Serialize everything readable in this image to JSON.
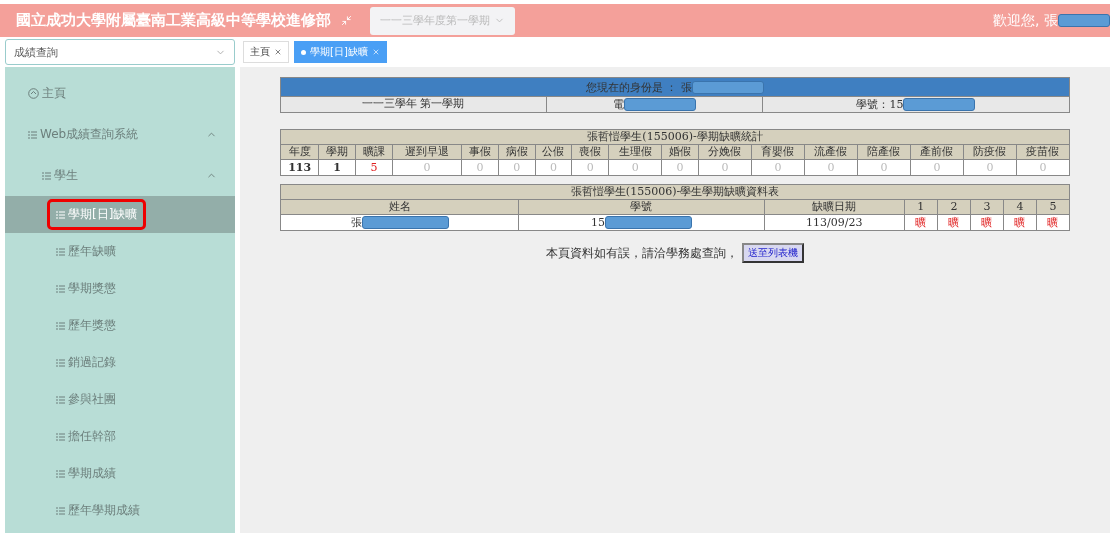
{
  "header": {
    "title": "國立成功大學附屬臺南工業高級中等學校進修部",
    "semester_select": {
      "placeholder": "一一三學年度第一學期"
    },
    "welcome": {
      "text": "歡迎您, 張",
      "redacted": true
    }
  },
  "module_select": {
    "value": "成績查詢"
  },
  "tabs": [
    {
      "label": "主頁",
      "selected": false
    },
    {
      "label": "學期[日]缺曠",
      "selected": true
    }
  ],
  "sidebar": {
    "items": [
      {
        "label": "主頁",
        "kind": "home",
        "selected": false,
        "highlighted": false
      },
      {
        "label": "Web成績查詢系統",
        "kind": "group",
        "expanded": true,
        "selected": false,
        "highlighted": false,
        "children": [
          {
            "label": "學生",
            "kind": "group",
            "expanded": true,
            "selected": false,
            "highlighted": false,
            "children": [
              {
                "label": "學期[日]缺曠",
                "kind": "leaf",
                "selected": true,
                "highlighted": true
              },
              {
                "label": "歷年缺曠",
                "kind": "leaf",
                "selected": false,
                "highlighted": false
              },
              {
                "label": "學期獎懲",
                "kind": "leaf",
                "selected": false,
                "highlighted": false
              },
              {
                "label": "歷年獎懲",
                "kind": "leaf",
                "selected": false,
                "highlighted": false
              },
              {
                "label": "銷過記錄",
                "kind": "leaf",
                "selected": false,
                "highlighted": false
              },
              {
                "label": "參與社團",
                "kind": "leaf",
                "selected": false,
                "highlighted": false
              },
              {
                "label": "擔任幹部",
                "kind": "leaf",
                "selected": false,
                "highlighted": false
              },
              {
                "label": "學期成績",
                "kind": "leaf",
                "selected": false,
                "highlighted": false
              },
              {
                "label": "歷年學期成績",
                "kind": "leaf",
                "selected": false,
                "highlighted": false
              }
            ]
          }
        ]
      }
    ]
  },
  "identity": {
    "title": {
      "text": "您現在的身份是 ： 張",
      "redacted": true
    },
    "cells": [
      {
        "text": "一一三學年 第一學期",
        "redacted": false
      },
      {
        "text": "電",
        "redacted": true
      },
      {
        "text": "學號：15",
        "redacted": true
      }
    ]
  },
  "stats": {
    "title": "張哲愷學生(155006)-學期缺曠統計",
    "columns": [
      "年度",
      "學期",
      "曠課",
      "遲到早退",
      "事假",
      "病假",
      "公假",
      "喪假",
      "生理假",
      "婚假",
      "分娩假",
      "育嬰假",
      "流產假",
      "陪產假",
      "產前假",
      "防疫假",
      "疫苗假"
    ],
    "rows": [
      [
        {
          "text": "113",
          "kind": "bold"
        },
        {
          "text": "1",
          "kind": "bold"
        },
        {
          "text": "5",
          "kind": "alert"
        },
        {
          "text": "0",
          "kind": "muted"
        },
        {
          "text": "0",
          "kind": "muted"
        },
        {
          "text": "0",
          "kind": "muted"
        },
        {
          "text": "0",
          "kind": "muted"
        },
        {
          "text": "0",
          "kind": "muted"
        },
        {
          "text": "0",
          "kind": "muted"
        },
        {
          "text": "0",
          "kind": "muted"
        },
        {
          "text": "0",
          "kind": "muted"
        },
        {
          "text": "0",
          "kind": "muted"
        },
        {
          "text": "0",
          "kind": "muted"
        },
        {
          "text": "0",
          "kind": "muted"
        },
        {
          "text": "0",
          "kind": "muted"
        },
        {
          "text": "0",
          "kind": "muted"
        },
        {
          "text": "0",
          "kind": "muted"
        }
      ]
    ]
  },
  "detail": {
    "title": "張哲愷學生(155006)-學生學期缺曠資料表",
    "columns": [
      "姓名",
      "學號",
      "缺曠日期",
      "1",
      "2",
      "3",
      "4",
      "5"
    ],
    "rows": [
      [
        {
          "text": "張",
          "kind": "plain",
          "redacted": true
        },
        {
          "text": "15",
          "kind": "plain",
          "redacted": true
        },
        {
          "text": "113/09/23",
          "kind": "plain",
          "redacted": false
        },
        {
          "text": "曠",
          "kind": "alert",
          "redacted": false
        },
        {
          "text": "曠",
          "kind": "alert",
          "redacted": false
        },
        {
          "text": "曠",
          "kind": "alert",
          "redacted": false
        },
        {
          "text": "曠",
          "kind": "alert",
          "redacted": false
        },
        {
          "text": "曠",
          "kind": "alert",
          "redacted": false
        }
      ]
    ]
  },
  "note": {
    "text": "本頁資料如有誤，請洽學務處查詢，",
    "button": "送至列表機"
  }
}
